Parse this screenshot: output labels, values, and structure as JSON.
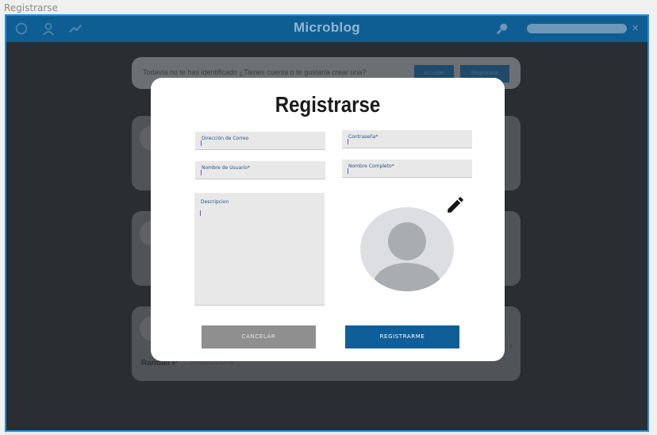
{
  "window": {
    "title": "Registrarse"
  },
  "appbar": {
    "title": "Microblog",
    "icons": [
      "home-icon",
      "user-icon",
      "trending-icon",
      "search-icon",
      "close-icon"
    ]
  },
  "background": {
    "banner_text": "Todavía no te has identificado ¿Tienes cuenta o te gustaría crear una?",
    "banner_buttons": [
      "Acceder",
      "Registrarte"
    ],
    "card_name": "Randall P",
    "card_date": "17/05/2021 15:06"
  },
  "modal": {
    "title": "Registrarse",
    "fields": {
      "email": {
        "label": "Dirección de Correo",
        "value": ""
      },
      "password": {
        "label": "Contraseña*",
        "value": ""
      },
      "username": {
        "label": "Nombre de Usuario*",
        "value": ""
      },
      "fullname": {
        "label": "Nombre Completo*",
        "value": ""
      },
      "description": {
        "label": "Descripcion",
        "value": ""
      }
    },
    "edit_icon": "pencil-icon",
    "avatar_icon": "default-avatar-icon",
    "cancel_label": "CANCELAR",
    "register_label": "REGISTRARME"
  },
  "colors": {
    "accent": "#0f5e99",
    "frame_border": "#1f8ee0",
    "label_blue": "#24548c"
  }
}
